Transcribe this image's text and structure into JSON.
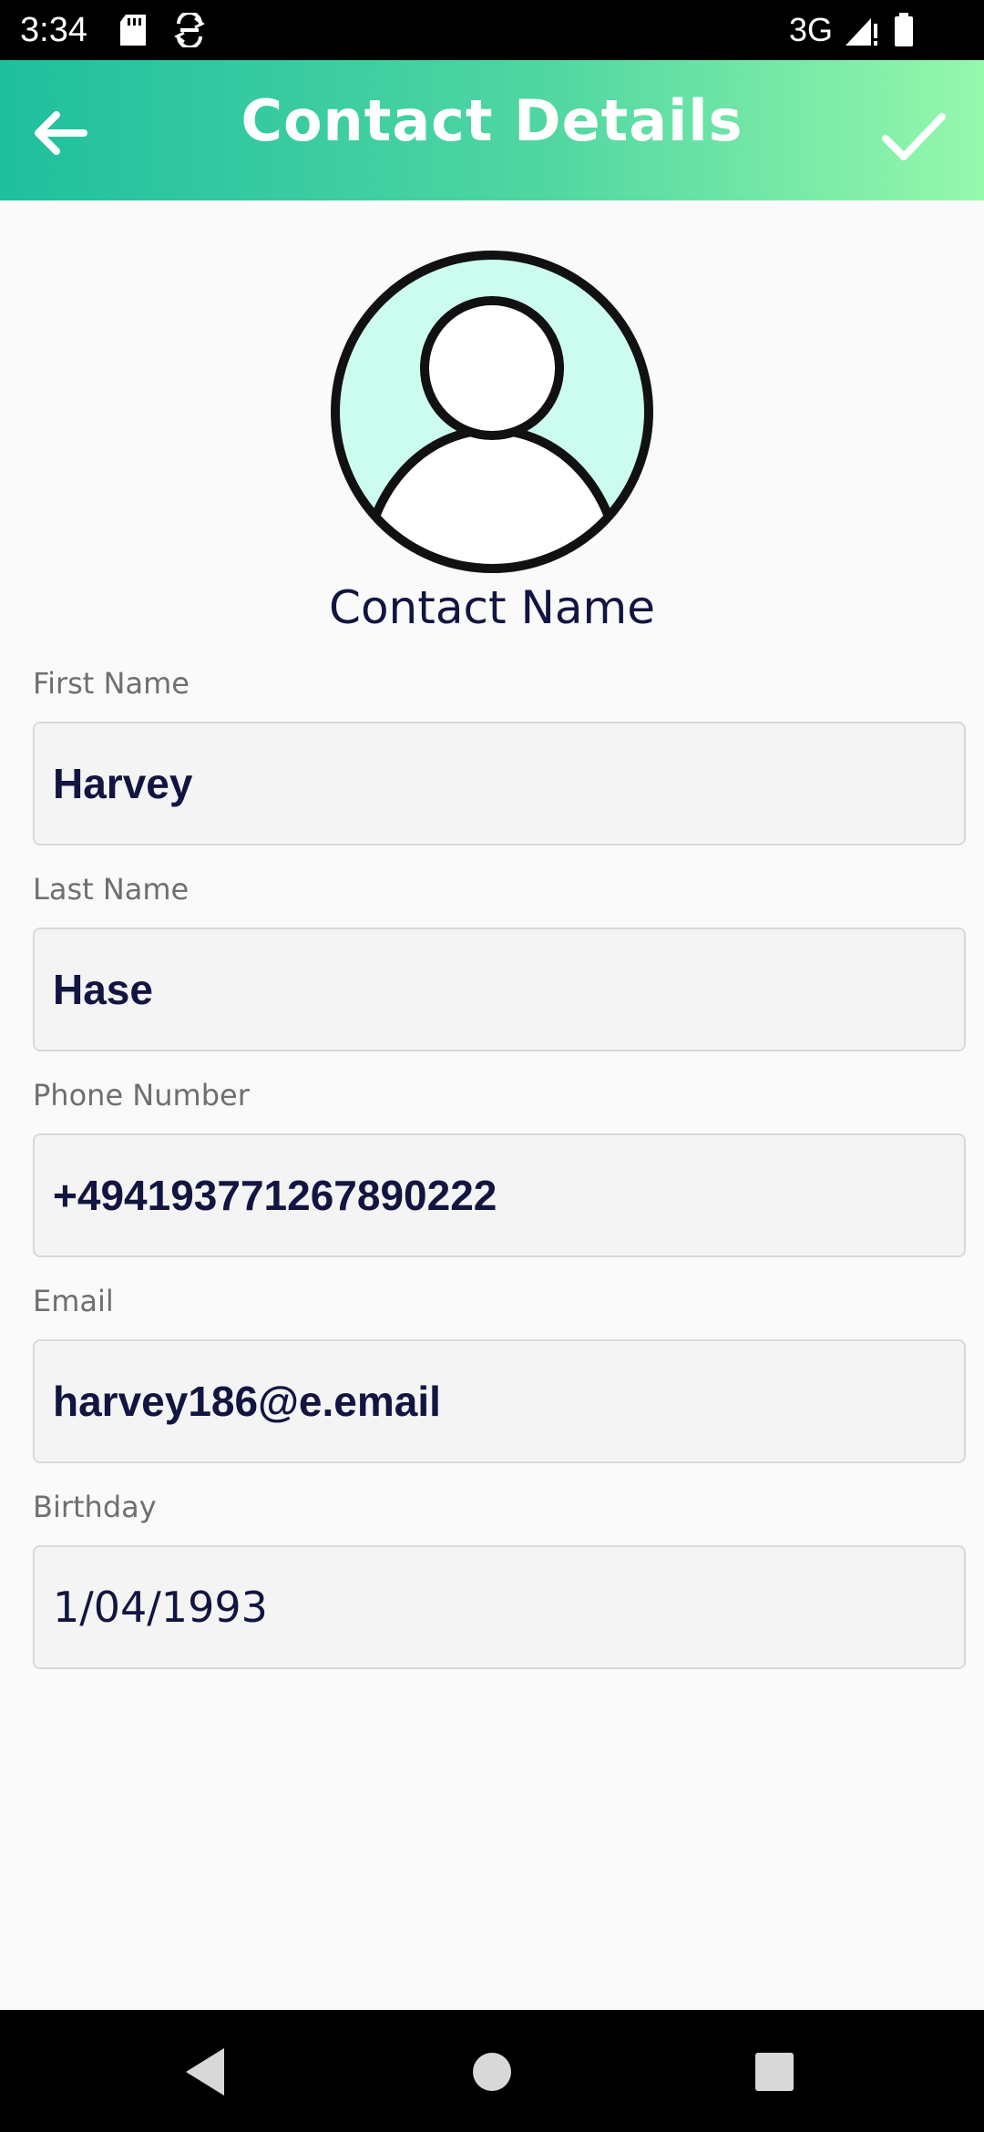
{
  "status_bar": {
    "time": "3:34",
    "network": "3G",
    "icons": [
      "sd-card-icon",
      "sync-icon",
      "signal-icon",
      "battery-icon"
    ]
  },
  "app_bar": {
    "title": "Contact Details",
    "back_icon": "arrow-back-icon",
    "save_icon": "checkmark-icon",
    "gradient": [
      "#1fbf9e",
      "#96f8ac"
    ]
  },
  "avatar": {
    "icon": "person-avatar-icon",
    "background_color": "#ccfcef"
  },
  "contact_name_heading": "Contact Name",
  "form": {
    "first_name": {
      "label": "First Name",
      "value": "Harvey"
    },
    "last_name": {
      "label": "Last Name",
      "value": "Hase"
    },
    "phone": {
      "label": "Phone Number",
      "value": "+494193771267890222"
    },
    "email": {
      "label": "Email",
      "value": "harvey186@e.email"
    },
    "birthday": {
      "label": "Birthday",
      "value": "1/04/1993"
    }
  },
  "nav_bar": {
    "back_icon": "nav-back-icon",
    "home_icon": "nav-home-icon",
    "recents_icon": "nav-recents-icon"
  },
  "colors": {
    "text_primary": "#121540",
    "label_gray": "#6f6f6f",
    "field_background": "#f4f4f4"
  }
}
